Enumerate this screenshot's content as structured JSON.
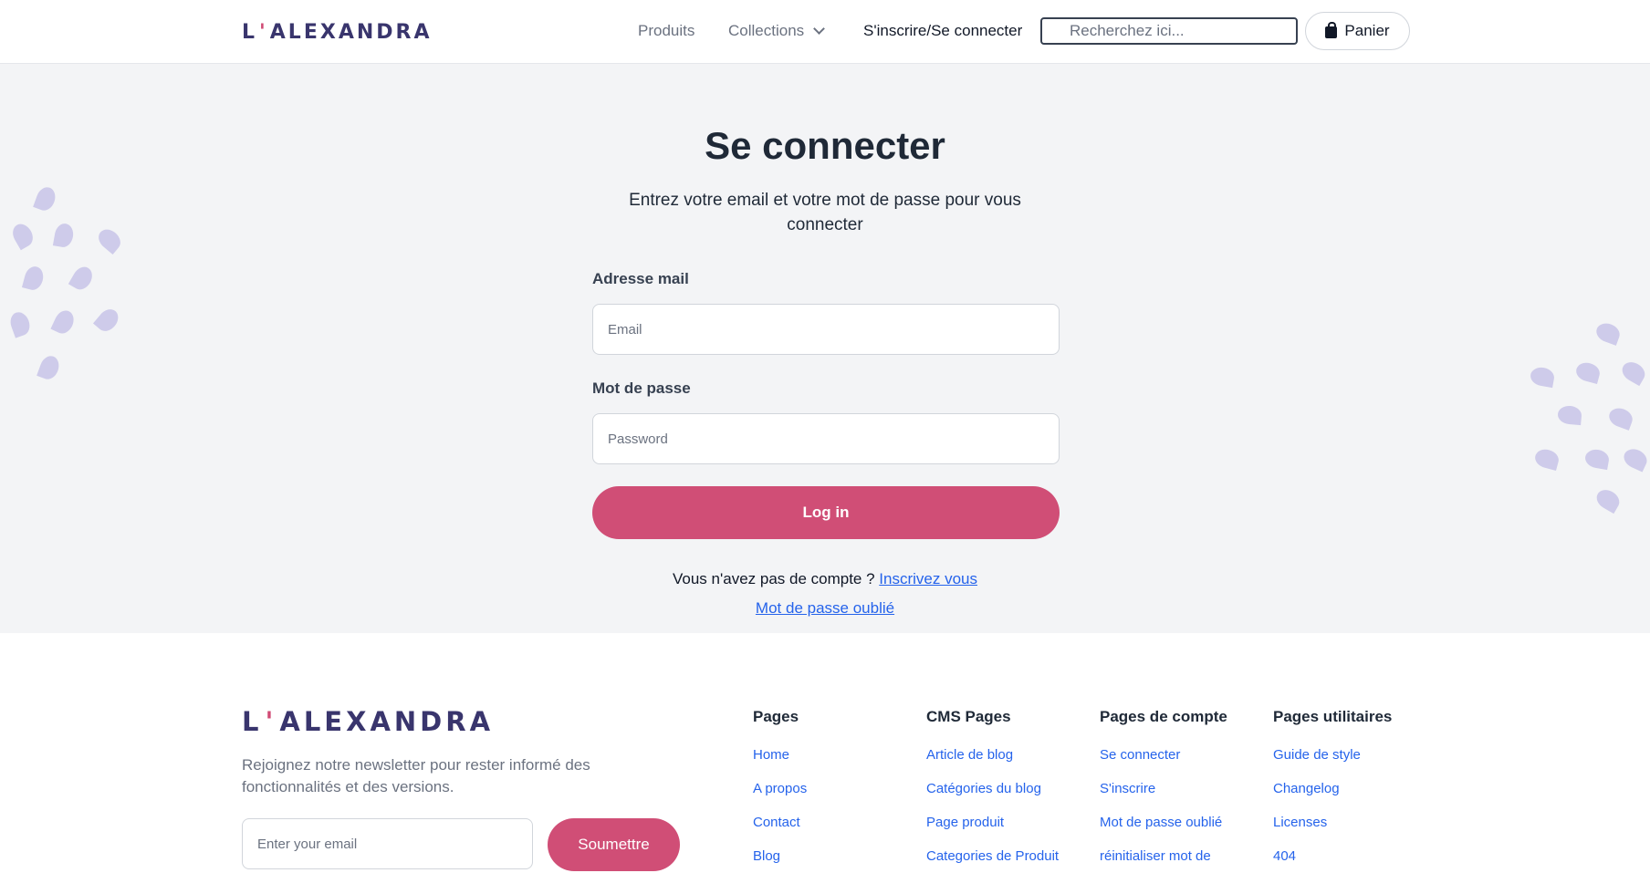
{
  "header": {
    "logo": {
      "part1": "L",
      "apos": "'",
      "part2": "ALEXANDRA"
    },
    "nav": {
      "produits": "Produits",
      "collections": "Collections",
      "account": "S'inscrire/Se connecter"
    },
    "search_placeholder": "Recherchez ici...",
    "cart_label": "Panier"
  },
  "login": {
    "title": "Se connecter",
    "subtitle": "Entrez votre email et votre mot de passe pour vous connecter",
    "email_label": "Adresse mail",
    "email_placeholder": "Email",
    "password_label": "Mot de passe",
    "password_placeholder": "Password",
    "submit_label": "Log in",
    "no_account_text": "Vous n'avez pas de compte ? ",
    "signup_link": "Inscrivez vous",
    "forgot_link": "Mot de passe oublié"
  },
  "footer": {
    "logo": {
      "part1": "L",
      "apos": "'",
      "part2": "ALEXANDRA"
    },
    "newsletter_text": "Rejoignez notre newsletter pour rester informé des fonctionnalités et des versions.",
    "newsletter_placeholder": "Enter your email",
    "submit_label": "Soumettre",
    "columns": [
      {
        "title": "Pages",
        "items": [
          "Home",
          "A propos",
          "Contact",
          "Blog"
        ]
      },
      {
        "title": "CMS Pages",
        "items": [
          "Article de blog",
          "Catégories du blog",
          "Page produit",
          "Categories de Produit"
        ]
      },
      {
        "title": "Pages de compte",
        "items": [
          "Se connecter",
          "S'inscrire",
          "Mot de passe oublié",
          "réinitialiser mot de"
        ]
      },
      {
        "title": "Pages utilitaires",
        "items": [
          "Guide de style",
          "Changelog",
          "Licenses",
          "404"
        ]
      }
    ]
  },
  "colors": {
    "brand": "#39356d",
    "accent": "#d04e76",
    "link": "#2563eb",
    "background": "#f3f4f6"
  }
}
